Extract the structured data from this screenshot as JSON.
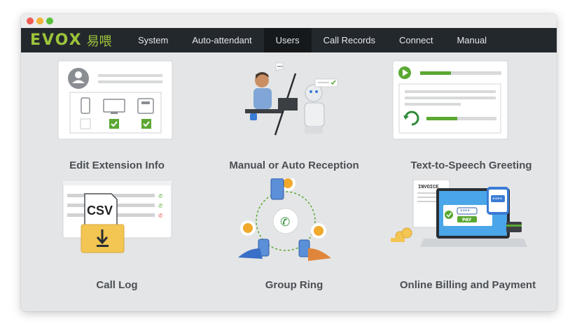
{
  "window": {
    "brand": "EVOX",
    "brand_cn": "易喂"
  },
  "nav": {
    "items": [
      {
        "label": "System",
        "active": false
      },
      {
        "label": "Auto-attendant",
        "active": false
      },
      {
        "label": "Users",
        "active": true
      },
      {
        "label": "Call Records",
        "active": false
      },
      {
        "label": "Connect",
        "active": false
      },
      {
        "label": "Manual",
        "active": false
      }
    ]
  },
  "cards": [
    {
      "label": "Edit Extension Info"
    },
    {
      "label": "Manual or Auto Reception"
    },
    {
      "label": "Text-to-Speech Greeting"
    },
    {
      "label": "Call Log"
    },
    {
      "label": "Group Ring"
    },
    {
      "label": "Online Billing and Payment"
    }
  ],
  "illustration_text": {
    "csv": "CSV",
    "invoice": "INVOICE",
    "pay": "PAY",
    "pin": "****"
  },
  "colors": {
    "accent": "#9cc33b",
    "nav_bg": "#23282d",
    "check_green": "#5aa832",
    "bell_orange": "#f0a92a"
  }
}
